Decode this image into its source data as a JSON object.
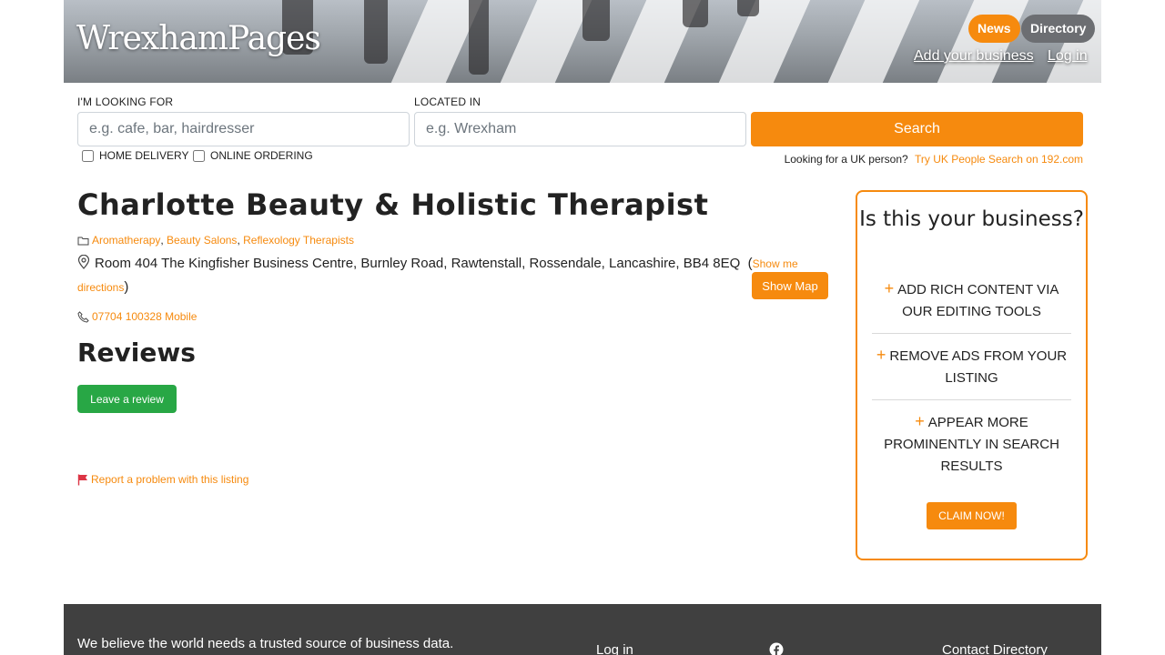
{
  "header": {
    "logo": "WrexhamPages",
    "news_label": "News",
    "directory_label": "Directory",
    "add_business_label": "Add your business",
    "login_label": "Log in"
  },
  "search": {
    "looking_for_label": "I'M LOOKING FOR",
    "looking_for_placeholder": "e.g. cafe, bar, hairdresser",
    "looking_for_value": "",
    "located_in_label": "LOCATED IN",
    "located_in_placeholder": "e.g. Wrexham",
    "located_in_value": "",
    "search_button": "Search",
    "home_delivery_label": "HOME DELIVERY",
    "home_delivery_checked": false,
    "online_ordering_label": "ONLINE ORDERING",
    "online_ordering_checked": false,
    "uk_person_prompt": "Looking for a UK person?",
    "uk_person_link": "Try UK People Search on 192.com"
  },
  "listing": {
    "title": "Charlotte Beauty & Holistic Therapist",
    "categories": [
      "Aromatherapy",
      "Beauty Salons",
      "Reflexology Therapists"
    ],
    "address": "Room 404 The Kingfisher Business Centre, Burnley Road, Rawtenstall, Rossendale, Lancashire, BB4 8EQ",
    "directions_link": "Show me directions",
    "show_map_button": "Show Map",
    "phone": "07704 100328 Mobile",
    "reviews_heading": "Reviews",
    "leave_review_button": "Leave a review",
    "report_link": "Report a problem with this listing"
  },
  "claim": {
    "heading": "Is this your business?",
    "benefits": [
      "ADD RICH CONTENT VIA OUR EDITING TOOLS",
      "REMOVE ADS FROM YOUR LISTING",
      "APPEAR MORE PROMINENTLY IN SEARCH RESULTS"
    ],
    "button": "CLAIM NOW!"
  },
  "footer": {
    "tagline": "We believe the world needs a trusted source of business data.",
    "login_link": "Log in",
    "contact_link": "Contact Directory"
  },
  "icons": {
    "category": "folder-icon",
    "address": "map-pin-icon",
    "phone": "phone-icon",
    "report": "flag-icon",
    "social": "facebook-icon",
    "benefit": "plus-icon"
  },
  "colors": {
    "accent": "#f68a0e",
    "review_button": "#28a745",
    "report_flag": "#dc3545",
    "footer_bg": "#404040",
    "directory_pill": "#6c6e72"
  }
}
